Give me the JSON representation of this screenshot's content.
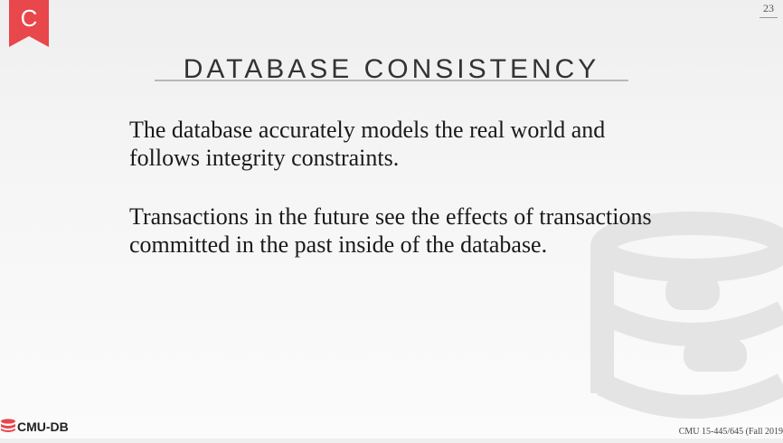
{
  "slide": {
    "page_number": "23",
    "badge_letter": "C",
    "title": "DATABASE CONSISTENCY",
    "paragraphs": [
      "The database accurately models the real world and follows integrity constraints.",
      "Transactions in the future see the effects of transactions committed in the past inside of the database."
    ],
    "footer_logo": "CMU-DB",
    "footer_course": "CMU 15-445/645 (Fall 2019"
  },
  "colors": {
    "accent": "#e8474b",
    "title_text": "#333333",
    "body_text": "#1a1a1a",
    "rule": "#b8b8b8",
    "watermark": "#e4e4e4"
  },
  "icons": {
    "badge": "bookmark-ribbon-icon",
    "logo": "database-stack-icon",
    "watermark": "database-cylinder-icon"
  }
}
